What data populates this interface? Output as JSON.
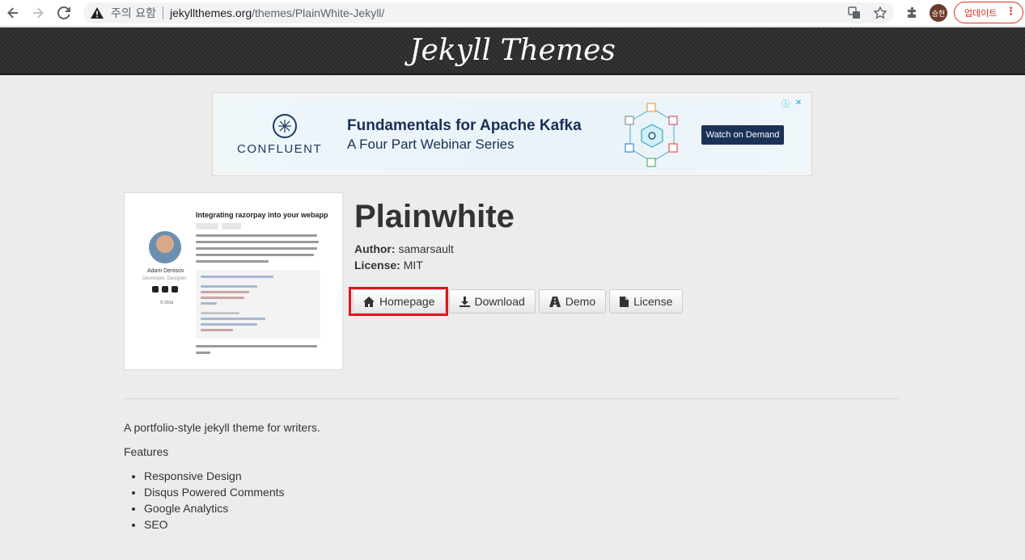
{
  "browser": {
    "security_label": "주의 요함",
    "url_domain": "jekyllthemes.org",
    "url_path": "/themes/PlainWhite-Jekyll/",
    "avatar_label": "승현",
    "update_label": "업데이트"
  },
  "site": {
    "title": "Jekyll Themes"
  },
  "ad": {
    "brand": "CONFLUENT",
    "headline": "Fundamentals for Apache Kafka",
    "subline": "A Four Part Webinar Series",
    "cta": "Watch on Demand"
  },
  "thumbnail": {
    "post_title": "Integrating razorpay into your webapp",
    "author_name": "Adam Denisov",
    "author_role": "Developer, Designer",
    "year": "© 2019"
  },
  "theme": {
    "name": "Plainwhite",
    "author_label": "Author:",
    "author": "samarsault",
    "license_label": "License:",
    "license": "MIT",
    "buttons": {
      "homepage": "Homepage",
      "download": "Download",
      "demo": "Demo",
      "license": "License"
    },
    "description": "A portfolio-style jekyll theme for writers.",
    "features_label": "Features",
    "features": [
      "Responsive Design",
      "Disqus Powered Comments",
      "Google Analytics",
      "SEO"
    ]
  },
  "colors": {
    "highlight": "#e0151f",
    "header_bg": "#2f2f2f",
    "page_bg": "#ececec"
  }
}
